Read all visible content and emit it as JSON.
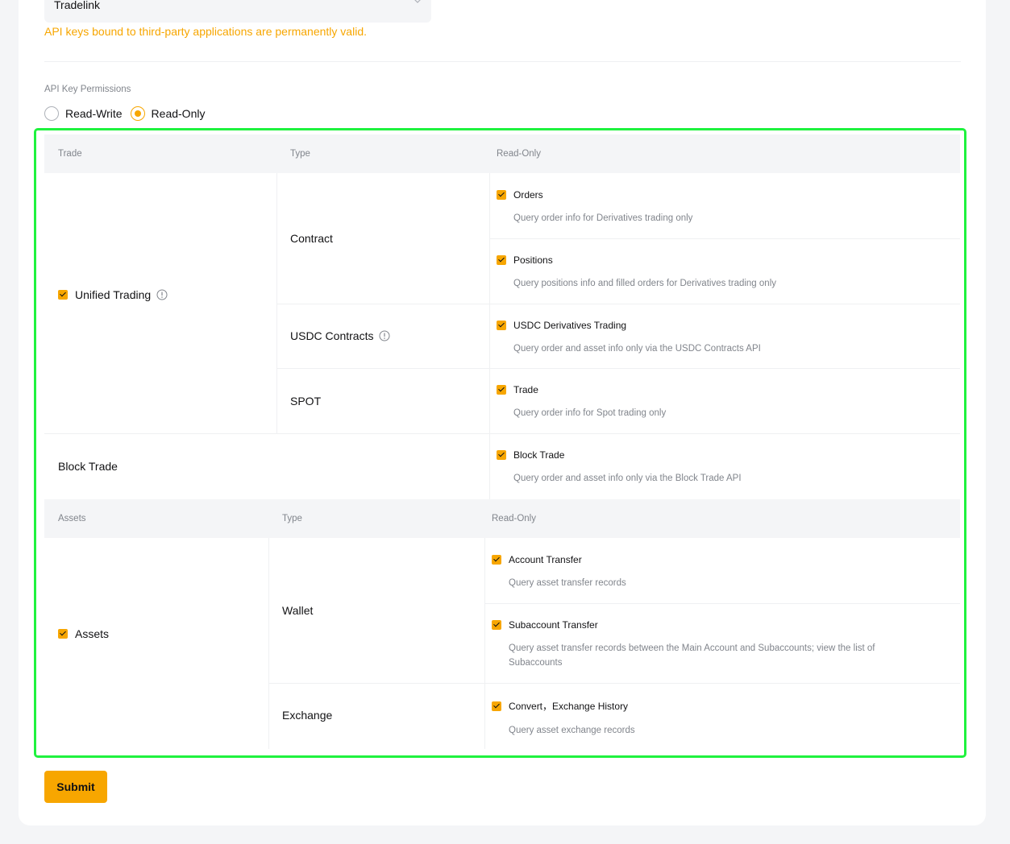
{
  "app_select": {
    "value": "Tradelink",
    "icon": "chevron-down-icon"
  },
  "note": "API keys bound to third-party applications are permanently valid.",
  "permissions": {
    "label": "API Key Permissions",
    "options": [
      {
        "label": "Read-Write",
        "checked": false
      },
      {
        "label": "Read-Only",
        "checked": true
      }
    ]
  },
  "trade_table": {
    "headers": {
      "col1": "Trade",
      "col2": "Type",
      "col3": "Read-Only"
    },
    "unified_trading": "Unified Trading",
    "contract": "Contract",
    "usdc_contracts": "USDC Contracts",
    "spot": "SPOT",
    "block_trade": "Block Trade",
    "perms": {
      "orders": {
        "title": "Orders",
        "desc": "Query order info for Derivatives trading only"
      },
      "positions": {
        "title": "Positions",
        "desc": "Query positions info and filled orders for Derivatives trading only"
      },
      "usdc": {
        "title": "USDC Derivatives Trading",
        "desc": "Query order and asset info only via the USDC Contracts API"
      },
      "trade": {
        "title": "Trade",
        "desc": "Query order info for Spot trading only"
      },
      "block": {
        "title": "Block Trade",
        "desc": "Query order and asset info only via the Block Trade API"
      }
    }
  },
  "assets_table": {
    "headers": {
      "col1": "Assets",
      "col2": "Type",
      "col3": "Read-Only"
    },
    "assets": "Assets",
    "wallet": "Wallet",
    "exchange": "Exchange",
    "perms": {
      "account_transfer": {
        "title": "Account Transfer",
        "desc": "Query asset transfer records"
      },
      "subaccount_transfer": {
        "title": "Subaccount Transfer",
        "desc": "Query asset transfer records between the Main Account and Subaccounts; view the list of Subaccounts"
      },
      "convert": {
        "title": "Convert，Exchange History",
        "desc": "Query asset exchange records"
      }
    }
  },
  "submit_label": "Submit",
  "colors": {
    "accent": "#f7a600",
    "highlight": "#1ff23e",
    "muted": "#81858c"
  }
}
